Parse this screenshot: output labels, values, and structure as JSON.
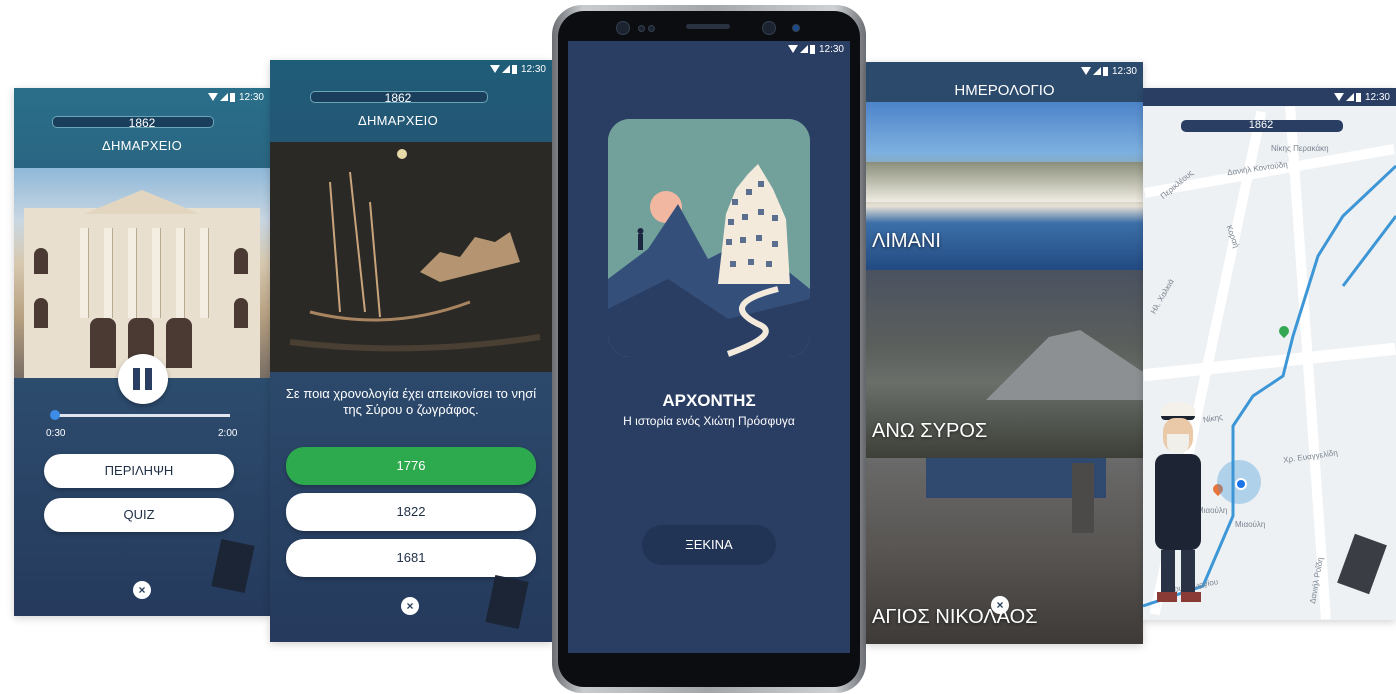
{
  "status": {
    "time": "12:30"
  },
  "screen1": {
    "year": "1862",
    "place": "ΔΗΜΑΡΧΕΙΟ",
    "player": {
      "elapsed": "0:30",
      "total": "2:00",
      "progress": 0.02
    },
    "buttons": {
      "summary": "ΠΕΡΙΛΗΨΗ",
      "quiz": "QUIZ"
    },
    "close": "×"
  },
  "screen2": {
    "year": "1862",
    "place": "ΔΗΜΑΡΧΕΙΟ",
    "question": "Σε ποια χρονολογία έχει απεικονίσει το νησί της Σύρου ο ζωγράφος.",
    "answers": [
      {
        "label": "1776",
        "correct": true
      },
      {
        "label": "1822",
        "correct": false
      },
      {
        "label": "1681",
        "correct": false
      }
    ],
    "close": "×"
  },
  "phone": {
    "app_title": "ΑΡΧΟΝΤΗΣ",
    "subtitle": "Η ιστορία ενός Χιώτη Πρόσφυγα",
    "start_button": "ΞΕΚΙΝΑ"
  },
  "screen4": {
    "title": "ΗΜΕΡΟΛΟΓΙΟ",
    "tiles": [
      {
        "label": "ΛΙΜΑΝΙ"
      },
      {
        "label": "ΑΝΩ ΣΥΡΟΣ"
      },
      {
        "label": "ΑΓΙΟΣ ΝΙΚΟΛΑΟΣ"
      }
    ],
    "close": "×"
  },
  "screen5": {
    "year": "1862",
    "streets": {
      "s1": "Νίκης Περακάκη",
      "s2": "Δανιήλ Κοντούδη",
      "s3": "Περικλέους",
      "s4": "Κοραή",
      "s5": "Χρ. Ευαγγελίδη",
      "s6": "Νίκης",
      "s7": "Αγίου Γεωργίου",
      "s8": "Ηλ. Χαλκιά",
      "s9": "Δανιήλ Ροΐδη",
      "poi1": "Μιαούλη",
      "poi2": "Μιαούλη"
    }
  },
  "colors": {
    "primary": "#2a3e64",
    "accent_green": "#2eaa4e",
    "teal": "#2a6f8a"
  }
}
